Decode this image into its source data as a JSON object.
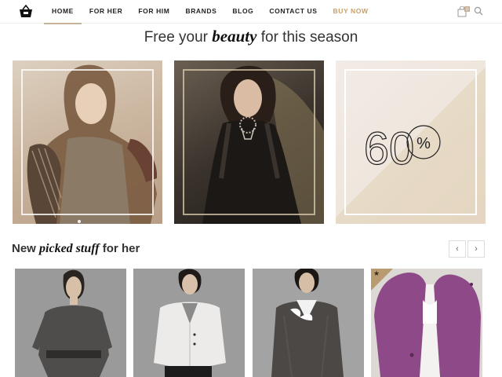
{
  "header": {
    "logo_icon": "shopping-basket-icon",
    "nav": [
      {
        "label": "HOME",
        "active": true
      },
      {
        "label": "FOR HER"
      },
      {
        "label": "FOR HIM"
      },
      {
        "label": "BRANDS"
      },
      {
        "label": "BLOG"
      },
      {
        "label": "CONTACT US"
      },
      {
        "label": "BUY NOW",
        "color": "#c7a06a"
      }
    ],
    "cart_icon": "shopping-bag-icon",
    "cart_count": "0",
    "search_icon": "search-icon"
  },
  "hero": {
    "title_pre": "Free your ",
    "title_em": "beauty",
    "title_post": " for this season",
    "tiles": [
      {
        "kind": "photo",
        "subject": "woman-casual-outfit"
      },
      {
        "kind": "photo",
        "subject": "woman-dark-lace-dress"
      },
      {
        "kind": "promo",
        "value": "60",
        "unit": "%"
      }
    ]
  },
  "section": {
    "title_pre": "New ",
    "title_em": "picked stuff",
    "title_post": " for her",
    "prev_icon": "chevron-left-icon",
    "next_icon": "chevron-right-icon"
  },
  "products": [
    {
      "subject": "gray-boatneck-top"
    },
    {
      "subject": "white-jacket"
    },
    {
      "subject": "tweed-blazer"
    },
    {
      "subject": "purple-coat",
      "badge_icon": "star-icon"
    }
  ],
  "colors": {
    "accent": "#c7b299",
    "buy_now": "#c7a06a",
    "promo_bg": "#efe6dd"
  }
}
